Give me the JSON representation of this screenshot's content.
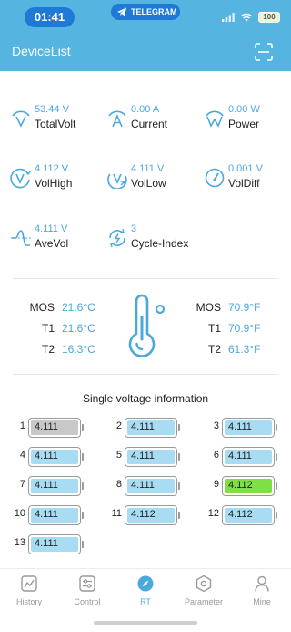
{
  "status_bar": {
    "time": "01:41",
    "telegram_label": "TELEGRAM",
    "battery": "100"
  },
  "header": {
    "title": "DeviceList"
  },
  "metrics": [
    {
      "value": "53.44 V",
      "label": "TotalVolt",
      "icon": "voltage-icon"
    },
    {
      "value": "0.00 A",
      "label": "Current",
      "icon": "current-icon"
    },
    {
      "value": "0.00 W",
      "label": "Power",
      "icon": "power-icon"
    },
    {
      "value": "4.112 V",
      "label": "VolHigh",
      "icon": "voltage-high-icon"
    },
    {
      "value": "4.111 V",
      "label": "VolLow",
      "icon": "voltage-low-icon"
    },
    {
      "value": "0.001 V",
      "label": "VolDiff",
      "icon": "gauge-icon"
    },
    {
      "value": "4.111 V",
      "label": "AveVol",
      "icon": "average-voltage-icon"
    },
    {
      "value": "3",
      "label": "Cycle-Index",
      "icon": "cycle-icon"
    }
  ],
  "temperatures": {
    "celsius": [
      {
        "label": "MOS",
        "value": "21.6°C"
      },
      {
        "label": "T1",
        "value": "21.6°C"
      },
      {
        "label": "T2",
        "value": "16.3°C"
      }
    ],
    "fahrenheit": [
      {
        "label": "MOS",
        "value": "70.9°F"
      },
      {
        "label": "T1",
        "value": "70.9°F"
      },
      {
        "label": "T2",
        "value": "61.3°F"
      }
    ]
  },
  "single_voltage": {
    "title": "Single voltage information",
    "colors": {
      "normal": "#a8dcf3",
      "low": "#c8c8c8",
      "high": "#7ee046"
    },
    "cells": [
      {
        "num": "1",
        "value": "4.111",
        "state": "low"
      },
      {
        "num": "2",
        "value": "4.111",
        "state": "normal"
      },
      {
        "num": "3",
        "value": "4.111",
        "state": "normal"
      },
      {
        "num": "4",
        "value": "4.111",
        "state": "normal"
      },
      {
        "num": "5",
        "value": "4.111",
        "state": "normal"
      },
      {
        "num": "6",
        "value": "4.111",
        "state": "normal"
      },
      {
        "num": "7",
        "value": "4.111",
        "state": "normal"
      },
      {
        "num": "8",
        "value": "4.111",
        "state": "normal"
      },
      {
        "num": "9",
        "value": "4.112",
        "state": "high"
      },
      {
        "num": "10",
        "value": "4.111",
        "state": "normal"
      },
      {
        "num": "11",
        "value": "4.112",
        "state": "normal"
      },
      {
        "num": "12",
        "value": "4.112",
        "state": "normal"
      },
      {
        "num": "13",
        "value": "4.111",
        "state": "normal"
      }
    ]
  },
  "bottom_nav": {
    "tabs": [
      {
        "label": "History",
        "icon": "history-chart-icon",
        "active": false
      },
      {
        "label": "Control",
        "icon": "control-sliders-icon",
        "active": false
      },
      {
        "label": "RT",
        "icon": "rt-compass-icon",
        "active": true
      },
      {
        "label": "Parameter",
        "icon": "parameter-hexagon-icon",
        "active": false
      },
      {
        "label": "Mine",
        "icon": "user-icon",
        "active": false
      }
    ]
  },
  "accent_color": "#56b4e0"
}
